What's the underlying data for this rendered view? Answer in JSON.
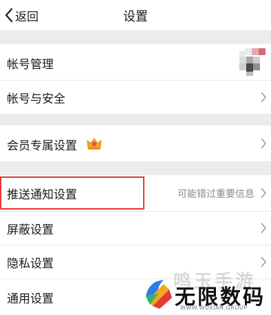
{
  "header": {
    "back_label": "返回",
    "title": "设置"
  },
  "groups": [
    {
      "items": [
        {
          "label": "帐号管理",
          "accessory": "avatar"
        },
        {
          "label": "帐号与安全",
          "accessory": "chevron"
        }
      ]
    },
    {
      "items": [
        {
          "label": "会员专属设置",
          "accessory": "chevron",
          "badge": "crown-icon"
        }
      ]
    },
    {
      "items": [
        {
          "label": "推送通知设置",
          "hint": "可能错过重要信息",
          "accessory": "chevron",
          "highlighted": true
        },
        {
          "label": "屏蔽设置",
          "accessory": "chevron"
        },
        {
          "label": "隐私设置",
          "accessory": "chevron"
        },
        {
          "label": "通用设置",
          "accessory": "chevron"
        }
      ]
    }
  ],
  "watermark": {
    "faint_text": "鸣玉手游",
    "text": "无限数码",
    "url": "WWW.WUXIAN.GROUP"
  },
  "colors": {
    "highlight": "#e53935",
    "background": "#f2f2f2",
    "row": "#ffffff"
  }
}
